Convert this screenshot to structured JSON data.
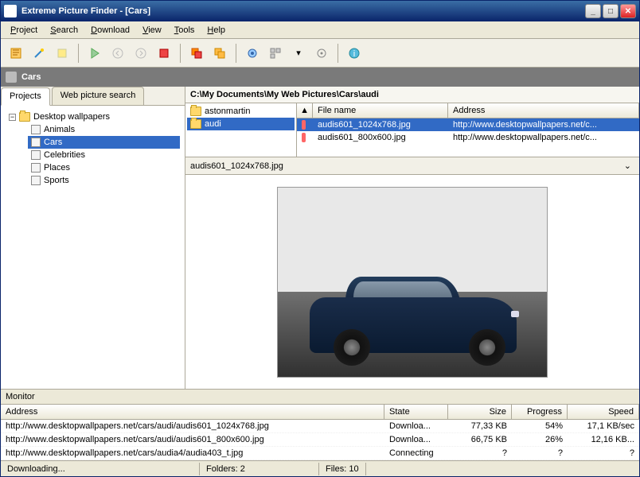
{
  "window": {
    "title": "Extreme Picture Finder - [Cars]"
  },
  "menu": [
    "Project",
    "Search",
    "Download",
    "View",
    "Tools",
    "Help"
  ],
  "subheader": {
    "title": "Cars"
  },
  "tabs": {
    "projects": "Projects",
    "websearch": "Web picture search"
  },
  "tree": {
    "root": "Desktop wallpapers",
    "children": [
      "Animals",
      "Cars",
      "Celebrities",
      "Places",
      "Sports"
    ],
    "selected": "Cars"
  },
  "path": "C:\\My Documents\\My Web Pictures\\Cars\\audi",
  "dirs": [
    "astonmartin",
    "audi"
  ],
  "dir_selected": "audi",
  "file_cols": {
    "name": "File name",
    "address": "Address"
  },
  "files": [
    {
      "name": "audis601_1024x768.jpg",
      "address": "http://www.desktopwallpapers.net/c..."
    },
    {
      "name": "audis601_800x600.jpg",
      "address": "http://www.desktopwallpapers.net/c..."
    }
  ],
  "file_selected": 0,
  "preview": {
    "filename": "audis601_1024x768.jpg"
  },
  "monitor": {
    "label": "Monitor",
    "cols": {
      "address": "Address",
      "state": "State",
      "size": "Size",
      "progress": "Progress",
      "speed": "Speed"
    },
    "rows": [
      {
        "address": "http://www.desktopwallpapers.net/cars/audi/audis601_1024x768.jpg",
        "state": "Downloa...",
        "size": "77,33 KB",
        "progress": "54%",
        "speed": "17,1 KB/sec"
      },
      {
        "address": "http://www.desktopwallpapers.net/cars/audi/audis601_800x600.jpg",
        "state": "Downloa...",
        "size": "66,75 KB",
        "progress": "26%",
        "speed": "12,16 KB..."
      },
      {
        "address": "http://www.desktopwallpapers.net/cars/audia4/audia403_t.jpg",
        "state": "Connecting",
        "size": "?",
        "progress": "?",
        "speed": "?"
      }
    ]
  },
  "status": {
    "state": "Downloading...",
    "folders": "Folders: 2",
    "files": "Files: 10"
  },
  "icons": {
    "toolbar": [
      "new-project",
      "wizard",
      "note",
      "play",
      "back",
      "forward",
      "stop",
      "stop-all",
      "queue",
      "sep",
      "settings",
      "view-mode",
      "dropdown",
      "target",
      "sep",
      "help"
    ]
  }
}
